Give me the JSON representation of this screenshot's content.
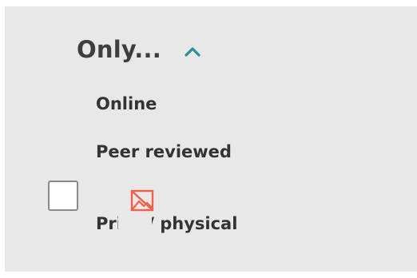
{
  "filter": {
    "heading": "Only...",
    "collapse_icon": "chevron-up-icon",
    "accent_color": "#2a8f9d",
    "items": [
      {
        "label": "Online"
      },
      {
        "label": "Peer reviewed"
      },
      {
        "label": "Print / physical",
        "checked": false
      }
    ]
  },
  "overlay": {
    "icon": "broken-image-icon",
    "color": "#f0614c"
  }
}
